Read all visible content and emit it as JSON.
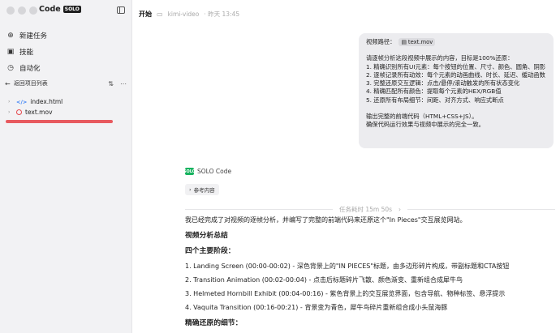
{
  "sidebar": {
    "app_badge": "Code",
    "app_badge_tag": "SOLO",
    "nav": [
      {
        "icon": "new-task-icon",
        "glyph": "⊕",
        "label": "新建任务"
      },
      {
        "icon": "skills-icon",
        "glyph": "▣",
        "label": "技能"
      },
      {
        "icon": "automation-icon",
        "glyph": "◷",
        "label": "自动化"
      }
    ],
    "project_back_label": "返回项目列表",
    "files": [
      {
        "name": "index.html",
        "icon": "html-file-icon"
      },
      {
        "name": "text.mov",
        "icon": "video-file-icon"
      }
    ]
  },
  "topbar": {
    "start_label": "开始",
    "project": "kimi-video",
    "meta": "· 昨天 13:45"
  },
  "user_message": {
    "path_label": "视频路径：",
    "path_file": "text.mov",
    "lines": [
      "请逐帧分析这段视频中展示的内容，目标是100%还原：",
      "1. 精确识别所有UI元素：每个按钮的位置、尺寸、颜色、圆角、阴影",
      "2. 逐帧记录所有动效：每个元素的动画曲线、时长、延迟、缓动函数",
      "3. 完整还原交互逻辑：点击/悬停/滚动触发的所有状态变化",
      "4. 精确匹配所有颜色：提取每个元素的HEX/RGB值",
      "5. 还原所有布局细节：间距、对齐方式、响应式断点"
    ],
    "lines2": [
      "输出完整的前端代码（HTML+CSS+JS）。",
      "确保代码运行效果与视频中展示的完全一致。"
    ]
  },
  "assistant": {
    "name": "SOLO Code",
    "logo_text": "SOLO",
    "ref_label": "参考内容",
    "duration": "任务耗时 15m 50s",
    "intro": "我已经完成了对视频的逐帧分析，并编写了完整的前端代码来还原这个\"In Pieces\"交互展览网站。",
    "h1": "视频分析总结",
    "h2": "四个主要阶段：",
    "stages": [
      "1. Landing Screen (00:00-00:02) - 深色背景上的\"IN PIECES\"标题，由多边形碎片构成，带副标题和CTA按钮",
      "2. Transition Animation (00:02-00:04) - 点击后标题碎片飞散、颜色渐变、重新组合成犀牛鸟",
      "3. Helmeted Hornbill Exhibit (00:04-00:16) - 紫色背景上的交互展览界面，包含导航、物种标签、悬浮提示",
      "4. Vaquita Transition (00:16-00:21) - 背景变为青色，犀牛鸟碎片重新组合成小头鼠海豚"
    ],
    "h3": "精确还原的细节："
  },
  "colors": {
    "sidebar_bg": "#f2f2f4",
    "bubble_bg": "#ececef",
    "accent_red": "#e85a5f",
    "solo_green": "#17b35f"
  }
}
